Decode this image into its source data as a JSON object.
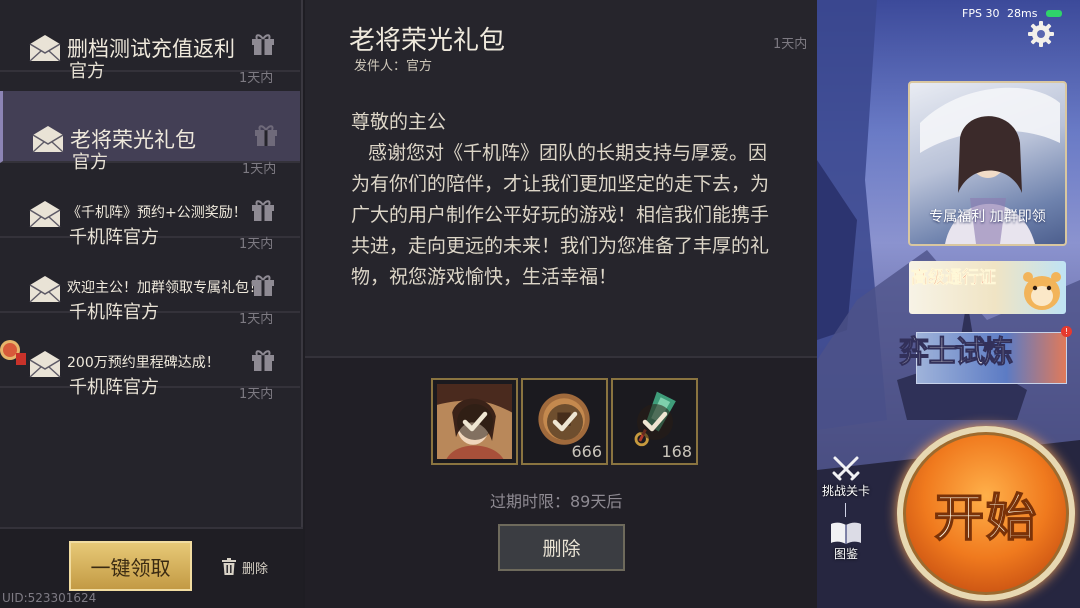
{
  "mail_list": {
    "items": [
      {
        "subject": "删档测试充值返利",
        "sender": "官方",
        "age": "1天内",
        "selected": false,
        "size": "big"
      },
      {
        "subject": "老将荣光礼包",
        "sender": "官方",
        "age": "1天内",
        "selected": true,
        "size": "big"
      },
      {
        "subject": "《千机阵》预约+公测奖励！",
        "sender": "千机阵官方",
        "age": "1天内",
        "selected": false,
        "size": "small"
      },
      {
        "subject": "欢迎主公！加群领取专属礼包！",
        "sender": "千机阵官方",
        "age": "1天内",
        "selected": false,
        "size": "small"
      },
      {
        "subject": "200万预约里程碑达成！",
        "sender": "千机阵官方",
        "age": "1天内",
        "selected": false,
        "size": "small"
      }
    ],
    "claim_all_label": "一键领取",
    "delete_label": "删除",
    "uid": "UID:523301624"
  },
  "detail": {
    "title": "老将荣光礼包",
    "sender_line": "发件人：官方",
    "age": "1天内",
    "greeting": "尊敬的主公",
    "body": "感谢您对《千机阵》团队的长期支持与厚爱。因为有你们的陪伴，才让我们更加坚定的走下去，为广大的用户制作公平好玩的游戏！相信我们能携手共进，走向更远的未来！我们为您准备了丰厚的礼物，祝您游戏愉快，生活幸福！",
    "attachments": [
      {
        "icon": "hero-portrait-icon",
        "quantity": "",
        "claimed": true
      },
      {
        "icon": "copper-coin-icon",
        "quantity": "666",
        "claimed": true
      },
      {
        "icon": "jade-token-icon",
        "quantity": "168",
        "claimed": true
      }
    ],
    "expiry": "过期时限：89天后",
    "delete_label": "删除"
  },
  "hud": {
    "fps": "FPS 30",
    "ping": "28ms",
    "welfare_label": "专属福利 加群即领",
    "pass_label": "高级通行证",
    "trial_label": "弈士试炼",
    "challenge_label": "挑战关卡",
    "codex_label": "图鉴",
    "start_label": "开始"
  },
  "colors": {
    "accent_gold": "#c39a44",
    "selected_row": "#433f55",
    "start_orange": "#f07a1e",
    "signal_green": "#2fd36a",
    "alert_red": "#e63a2e"
  }
}
